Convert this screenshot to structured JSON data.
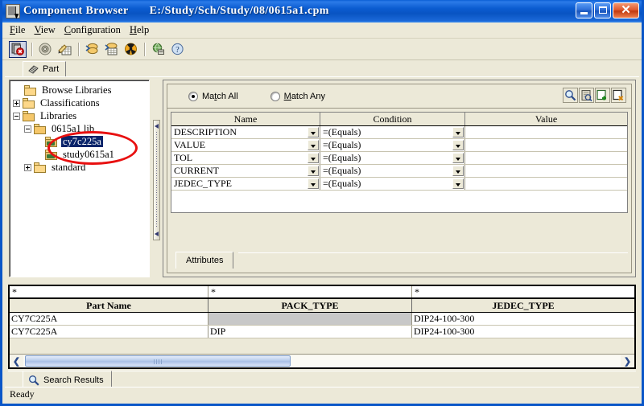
{
  "window": {
    "app_title": "Component Browser",
    "document_path": "E:/Study/Sch/Study/08/0615a1.cpm",
    "icon": "component-browser-icon",
    "controls": {
      "minimize": "minimize-button",
      "maximize": "maximize-button",
      "close": "close-button"
    }
  },
  "menubar": {
    "items": [
      {
        "label": "File",
        "accel": "F"
      },
      {
        "label": "View",
        "accel": "V"
      },
      {
        "label": "Configuration",
        "accel": "C"
      },
      {
        "label": "Help",
        "accel": "H"
      }
    ]
  },
  "toolbar": {
    "buttons": [
      {
        "name": "close-database-icon",
        "tip": "Close"
      },
      {
        "name": "disc-icon",
        "tip": "Browse"
      },
      {
        "name": "edit-table-icon",
        "tip": "Edit"
      },
      {
        "name": "import-part-icon",
        "tip": "Import"
      },
      {
        "name": "export-table-icon",
        "tip": "Export"
      },
      {
        "name": "radiation-icon",
        "tip": "Delete"
      },
      {
        "name": "globe-sync-icon",
        "tip": "Synchronize"
      },
      {
        "name": "help-icon",
        "tip": "Help"
      }
    ]
  },
  "main_tab": {
    "label": "Part",
    "icon": "chip-icon"
  },
  "tree": {
    "nodes": [
      {
        "label": "Browse Libraries",
        "depth": 1,
        "toggle": "none",
        "folder": "closed",
        "selected": false
      },
      {
        "label": "Classifications",
        "depth": 0,
        "toggle": "plus",
        "folder": "closed",
        "selected": false
      },
      {
        "label": "Libraries",
        "depth": 0,
        "toggle": "minus",
        "folder": "open",
        "selected": false
      },
      {
        "label": "0615a1 lib",
        "depth": 1,
        "toggle": "minus",
        "folder": "open",
        "selected": false
      },
      {
        "label": "cy7c225a",
        "depth": 2,
        "toggle": "none",
        "folder": "leaf",
        "selected": true
      },
      {
        "label": "study0615a1",
        "depth": 2,
        "toggle": "none",
        "folder": "leaf",
        "selected": false
      },
      {
        "label": "standard",
        "depth": 1,
        "toggle": "plus",
        "folder": "closed",
        "selected": false
      }
    ]
  },
  "filter": {
    "match_all": {
      "label": "Match All",
      "accel": "t",
      "checked": true
    },
    "match_any": {
      "label": "Match Any",
      "accel": "M",
      "checked": false
    },
    "tools": [
      {
        "name": "search-icon",
        "tip": "Search"
      },
      {
        "name": "clear-history-icon",
        "tip": "Clear"
      },
      {
        "name": "add-criteria-icon",
        "tip": "Add"
      },
      {
        "name": "delete-criteria-icon",
        "tip": "Delete"
      }
    ],
    "columns": [
      "Name",
      "Condition",
      "Value"
    ],
    "rows": [
      {
        "name": "DESCRIPTION",
        "condition": "=(Equals)",
        "value": ""
      },
      {
        "name": "VALUE",
        "condition": "=(Equals)",
        "value": ""
      },
      {
        "name": "TOL",
        "condition": "=(Equals)",
        "value": ""
      },
      {
        "name": "CURRENT",
        "condition": "=(Equals)",
        "value": ""
      },
      {
        "name": "JEDEC_TYPE",
        "condition": "=(Equals)",
        "value": ""
      }
    ],
    "tab_label": "Attributes"
  },
  "results": {
    "filter_row": [
      "*",
      "*",
      "*"
    ],
    "columns": [
      "Part Name",
      "PACK_TYPE",
      "JEDEC_TYPE"
    ],
    "rows": [
      {
        "part_name": "CY7C225A",
        "pack_type": "",
        "jedec_type": "DIP24-100-300",
        "pack_selected": true
      },
      {
        "part_name": "CY7C225A",
        "pack_type": "DIP",
        "jedec_type": "DIP24-100-300",
        "pack_selected": false
      }
    ],
    "scroll": {
      "left_arrow": "❮",
      "right_arrow": "❯"
    },
    "tab": {
      "label": "Search Results",
      "icon": "magnifier-icon"
    }
  },
  "statusbar": {
    "text": "Ready"
  },
  "annotation": {
    "shape": "ellipse",
    "color": "#e81010",
    "target": "library-parts-highlight"
  },
  "colors": {
    "titlebar": "#0a56c8",
    "face": "#ece9d8",
    "selection": "#0a246a",
    "annotation": "#e81010",
    "grid_selected_cell": "#c8c8c8"
  }
}
